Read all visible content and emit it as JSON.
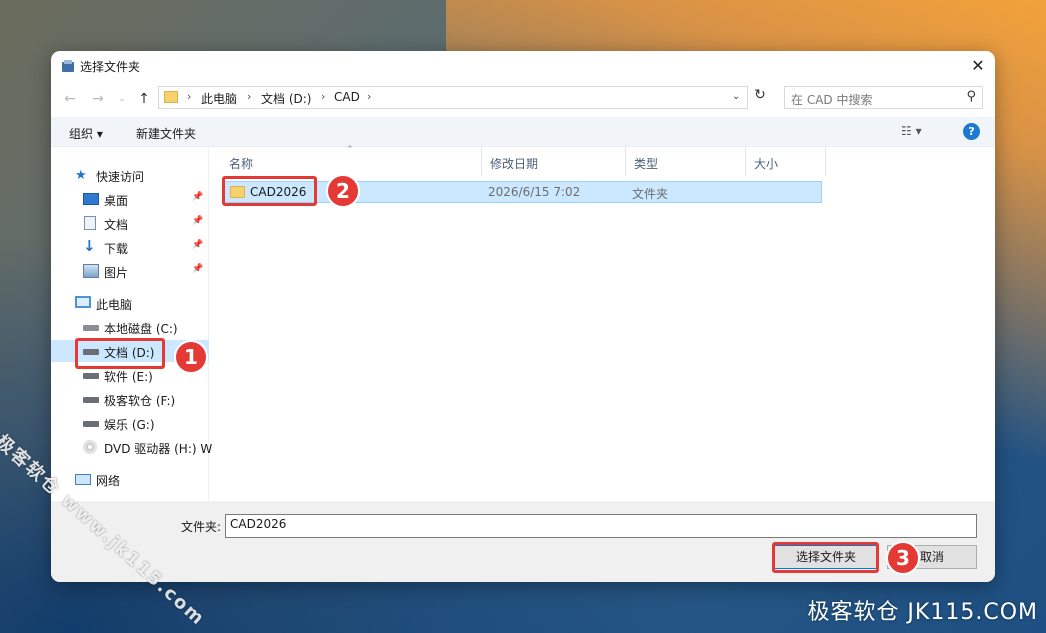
{
  "window": {
    "title": "选择文件夹",
    "close_label": "✕"
  },
  "address": {
    "crumbs": [
      "此电脑",
      "文档 (D:)",
      "CAD"
    ],
    "search_placeholder": "在 CAD 中搜索"
  },
  "toolbar": {
    "organize": "组织 ▾",
    "new_folder": "新建文件夹",
    "help": "?"
  },
  "sidebar": {
    "quick_access": "快速访问",
    "quick_items": [
      "桌面",
      "文档",
      "下载",
      "图片"
    ],
    "this_pc": "此电脑",
    "drives": [
      "本地磁盘 (C:)",
      "文档 (D:)",
      "软件 (E:)",
      "极客软仓 (F:)",
      "娱乐 (G:)",
      "DVD 驱动器 (H:) W"
    ],
    "network": "网络"
  },
  "columns": {
    "name": "名称",
    "modified": "修改日期",
    "type": "类型",
    "size": "大小"
  },
  "rows": [
    {
      "name": "CAD2026",
      "modified": "2026/6/15 7:02",
      "type": "文件夹",
      "size": ""
    }
  ],
  "footer": {
    "folder_label": "文件夹:",
    "folder_value": "CAD2026",
    "select_button": "选择文件夹",
    "cancel_button": "取消"
  },
  "annotations": {
    "badge1": "1",
    "badge2": "2",
    "badge3": "3"
  },
  "watermarks": {
    "diagonal": "极客软仓 www.jk115.com",
    "corner": "极客软仓 JK115.COM"
  },
  "colors": {
    "selection": "#cce8ff",
    "callout": "#e53935",
    "accent": "#0078d7"
  }
}
